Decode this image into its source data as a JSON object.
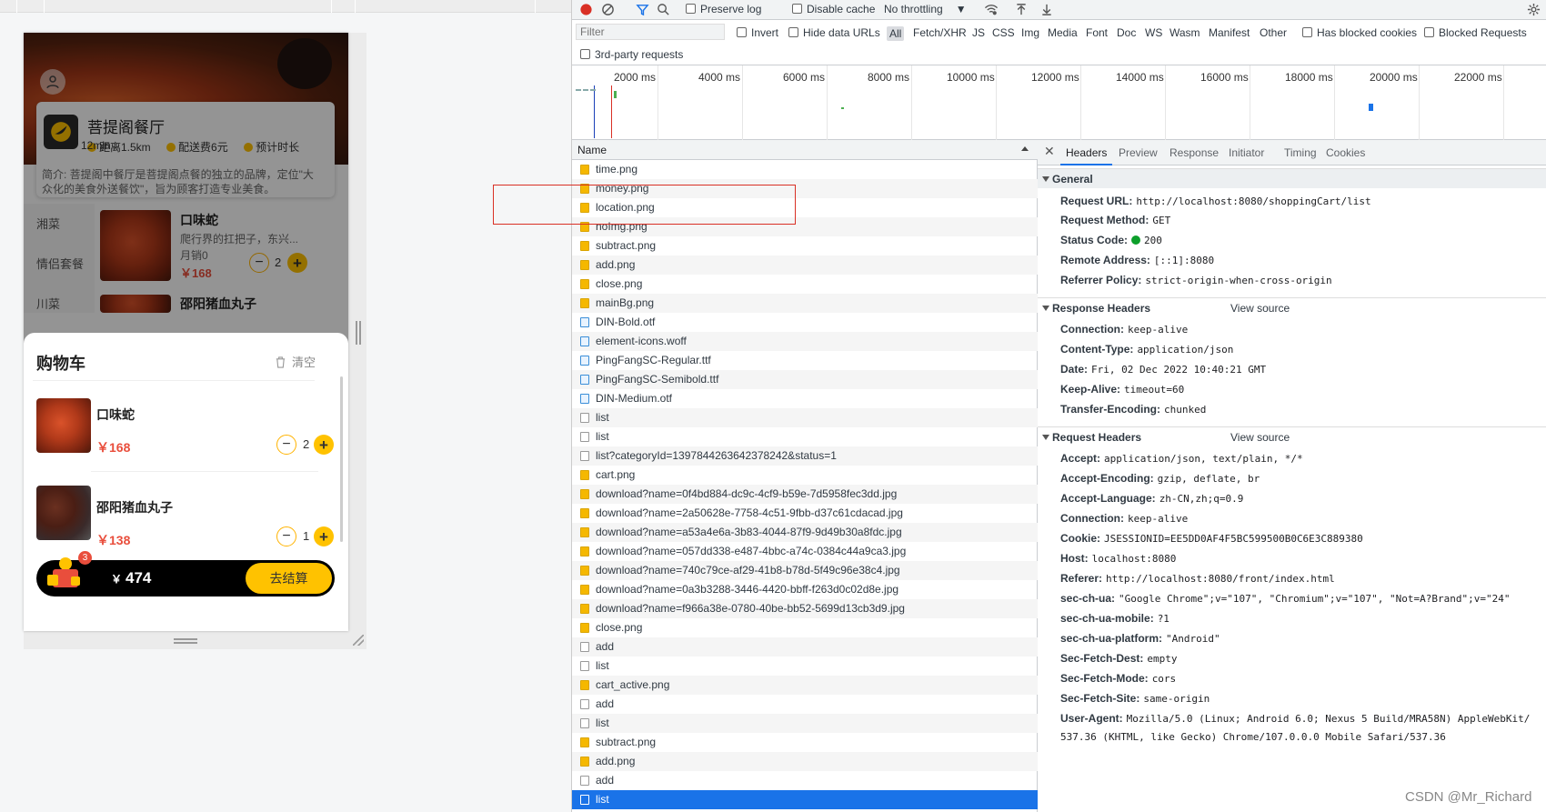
{
  "mobile": {
    "shop_name": "菩提阁餐厅",
    "distance": "距离1.5km",
    "delivery_fee": "配送费6元",
    "eta": "预计时长",
    "eta_cont": "12min",
    "intro": "简介: 菩提阁中餐厅是菩提阁点餐的独立的品牌，定位\"大众化的美食外送餐饮\"，旨为顾客打造专业美食。",
    "categories": [
      "湘菜",
      "情侣套餐",
      "川菜"
    ],
    "dishes": [
      {
        "name": "口味蛇",
        "desc": "爬行界的扛把子，东兴...",
        "sales": "月销0",
        "price": "￥168",
        "qty": "2"
      },
      {
        "name": "邵阳猪血丸子",
        "desc": "",
        "sales": "",
        "price": "",
        "qty": ""
      }
    ],
    "cart": {
      "title": "购物车",
      "clear_label": "清空",
      "items": [
        {
          "name": "口味蛇",
          "price": "￥168",
          "qty": "2"
        },
        {
          "name": "邵阳猪血丸子",
          "price": "￥138",
          "qty": "1"
        }
      ],
      "badge": "3",
      "currency": "￥",
      "total": "474",
      "checkout_label": "去结算"
    }
  },
  "devtools": {
    "toolbar": {
      "preserve_log": "Preserve log",
      "disable_cache": "Disable cache",
      "throttling": "No throttling"
    },
    "filter": {
      "placeholder": "Filter",
      "invert": "Invert",
      "hide_data_urls": "Hide data URLs",
      "types": [
        "All",
        "Fetch/XHR",
        "JS",
        "CSS",
        "Img",
        "Media",
        "Font",
        "Doc",
        "WS",
        "Wasm",
        "Manifest",
        "Other"
      ],
      "has_blocked_cookies": "Has blocked cookies",
      "blocked_requests": "Blocked Requests",
      "third_party": "3rd-party requests"
    },
    "timeline_ticks": [
      "2000 ms",
      "4000 ms",
      "6000 ms",
      "8000 ms",
      "10000 ms",
      "12000 ms",
      "14000 ms",
      "16000 ms",
      "18000 ms",
      "20000 ms",
      "22000 ms"
    ],
    "list_header": "Name",
    "requests": [
      {
        "name": "time.png",
        "kind": "img"
      },
      {
        "name": "money.png",
        "kind": "img"
      },
      {
        "name": "location.png",
        "kind": "img"
      },
      {
        "name": "noImg.png",
        "kind": "img"
      },
      {
        "name": "subtract.png",
        "kind": "img"
      },
      {
        "name": "add.png",
        "kind": "img"
      },
      {
        "name": "close.png",
        "kind": "img"
      },
      {
        "name": "mainBg.png",
        "kind": "img"
      },
      {
        "name": "DIN-Bold.otf",
        "kind": "font"
      },
      {
        "name": "element-icons.woff",
        "kind": "font"
      },
      {
        "name": "PingFangSC-Regular.ttf",
        "kind": "font"
      },
      {
        "name": "PingFangSC-Semibold.ttf",
        "kind": "font"
      },
      {
        "name": "DIN-Medium.otf",
        "kind": "font"
      },
      {
        "name": "list",
        "kind": "doc"
      },
      {
        "name": "list",
        "kind": "doc"
      },
      {
        "name": "list?categoryId=1397844263642378242&status=1",
        "kind": "doc"
      },
      {
        "name": "cart.png",
        "kind": "img"
      },
      {
        "name": "download?name=0f4bd884-dc9c-4cf9-b59e-7d5958fec3dd.jpg",
        "kind": "img"
      },
      {
        "name": "download?name=2a50628e-7758-4c51-9fbb-d37c61cdacad.jpg",
        "kind": "img"
      },
      {
        "name": "download?name=a53a4e6a-3b83-4044-87f9-9d49b30a8fdc.jpg",
        "kind": "img"
      },
      {
        "name": "download?name=057dd338-e487-4bbc-a74c-0384c44a9ca3.jpg",
        "kind": "img"
      },
      {
        "name": "download?name=740c79ce-af29-41b8-b78d-5f49c96e38c4.jpg",
        "kind": "img"
      },
      {
        "name": "download?name=0a3b3288-3446-4420-bbff-f263d0c02d8e.jpg",
        "kind": "img"
      },
      {
        "name": "download?name=f966a38e-0780-40be-bb52-5699d13cb3d9.jpg",
        "kind": "img"
      },
      {
        "name": "close.png",
        "kind": "img"
      },
      {
        "name": "add",
        "kind": "doc"
      },
      {
        "name": "list",
        "kind": "doc"
      },
      {
        "name": "cart_active.png",
        "kind": "img"
      },
      {
        "name": "add",
        "kind": "doc"
      },
      {
        "name": "list",
        "kind": "doc"
      },
      {
        "name": "subtract.png",
        "kind": "img"
      },
      {
        "name": "add.png",
        "kind": "img"
      },
      {
        "name": "add",
        "kind": "doc"
      },
      {
        "name": "list",
        "kind": "doc",
        "selected": true
      }
    ],
    "detail_tabs": [
      "Headers",
      "Preview",
      "Response",
      "Initiator",
      "Timing",
      "Cookies"
    ],
    "general": {
      "title": "General",
      "rows": [
        {
          "k": "Request URL:",
          "v": "http://localhost:8080/shoppingCart/list"
        },
        {
          "k": "Request Method:",
          "v": "GET"
        },
        {
          "k": "Status Code:",
          "v": "200"
        },
        {
          "k": "Remote Address:",
          "v": "[::1]:8080"
        },
        {
          "k": "Referrer Policy:",
          "v": "strict-origin-when-cross-origin"
        }
      ]
    },
    "response_headers": {
      "title": "Response Headers",
      "view_source": "View source",
      "rows": [
        {
          "k": "Connection:",
          "v": "keep-alive"
        },
        {
          "k": "Content-Type:",
          "v": "application/json"
        },
        {
          "k": "Date:",
          "v": "Fri, 02 Dec 2022 10:40:21 GMT"
        },
        {
          "k": "Keep-Alive:",
          "v": "timeout=60"
        },
        {
          "k": "Transfer-Encoding:",
          "v": "chunked"
        }
      ]
    },
    "request_headers": {
      "title": "Request Headers",
      "view_source": "View source",
      "rows": [
        {
          "k": "Accept:",
          "v": "application/json, text/plain, */*"
        },
        {
          "k": "Accept-Encoding:",
          "v": "gzip, deflate, br"
        },
        {
          "k": "Accept-Language:",
          "v": "zh-CN,zh;q=0.9"
        },
        {
          "k": "Connection:",
          "v": "keep-alive"
        },
        {
          "k": "Cookie:",
          "v": "JSESSIONID=EE5DD0AF4F5BC599500B0C6E3C889380"
        },
        {
          "k": "Host:",
          "v": "localhost:8080"
        },
        {
          "k": "Referer:",
          "v": "http://localhost:8080/front/index.html"
        },
        {
          "k": "sec-ch-ua:",
          "v": "\"Google Chrome\";v=\"107\", \"Chromium\";v=\"107\", \"Not=A?Brand\";v=\"24\""
        },
        {
          "k": "sec-ch-ua-mobile:",
          "v": "?1"
        },
        {
          "k": "sec-ch-ua-platform:",
          "v": "\"Android\""
        },
        {
          "k": "Sec-Fetch-Dest:",
          "v": "empty"
        },
        {
          "k": "Sec-Fetch-Mode:",
          "v": "cors"
        },
        {
          "k": "Sec-Fetch-Site:",
          "v": "same-origin"
        },
        {
          "k": "User-Agent:",
          "v": "Mozilla/5.0 (Linux; Android 6.0; Nexus 5 Build/MRA58N) AppleWebKit/"
        }
      ],
      "ua_cont": "537.36 (KHTML, like Gecko) Chrome/107.0.0.0 Mobile Safari/537.36"
    }
  },
  "watermark": "CSDN @Mr_Richard",
  "colors": {
    "accent": "#1a73e8",
    "brand_yellow": "#ffc200",
    "price_red": "#e94e3c",
    "highlight_box": "#d93025"
  }
}
